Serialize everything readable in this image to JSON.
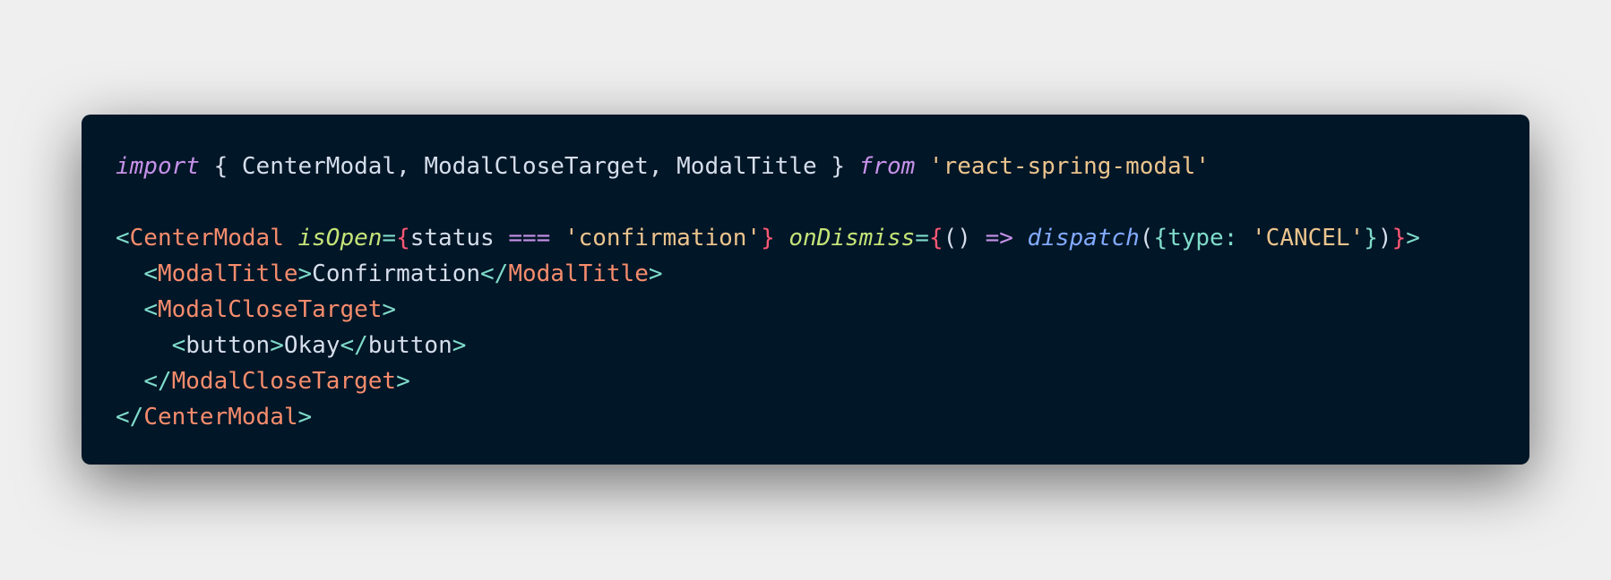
{
  "colors": {
    "page_background": "#efefef",
    "editor_background": "#011627",
    "plain": "#d6deeb",
    "keyword": "#c792ea",
    "string": "#ecc48d",
    "tag_bracket": "#7fdbca",
    "component": "#f78c6c",
    "attribute": "#c5e478",
    "jsx_brace": "#ff5874",
    "operator": "#c792ea",
    "function": "#82aaff"
  },
  "code": {
    "language": "jsx",
    "lines": [
      [
        {
          "text": "import",
          "role": "keyword",
          "italic": true
        },
        {
          "text": " { CenterModal, ModalCloseTarget, ModalTitle } ",
          "role": "plain"
        },
        {
          "text": "from",
          "role": "keyword",
          "italic": true
        },
        {
          "text": " ",
          "role": "plain"
        },
        {
          "text": "'react-spring-modal'",
          "role": "string"
        }
      ],
      [],
      [
        {
          "text": "<",
          "role": "tag_bracket"
        },
        {
          "text": "CenterModal",
          "role": "component"
        },
        {
          "text": " ",
          "role": "plain"
        },
        {
          "text": "isOpen",
          "role": "attribute",
          "italic": true
        },
        {
          "text": "=",
          "role": "tag_bracket"
        },
        {
          "text": "{",
          "role": "jsx_brace"
        },
        {
          "text": "status ",
          "role": "plain"
        },
        {
          "text": "===",
          "role": "operator"
        },
        {
          "text": " ",
          "role": "plain"
        },
        {
          "text": "'confirmation'",
          "role": "string"
        },
        {
          "text": "}",
          "role": "jsx_brace"
        },
        {
          "text": " ",
          "role": "plain"
        },
        {
          "text": "onDismiss",
          "role": "attribute",
          "italic": true
        },
        {
          "text": "=",
          "role": "tag_bracket"
        },
        {
          "text": "{",
          "role": "jsx_brace"
        },
        {
          "text": "() ",
          "role": "plain"
        },
        {
          "text": "=>",
          "role": "operator"
        },
        {
          "text": " ",
          "role": "plain"
        },
        {
          "text": "dispatch",
          "role": "function",
          "italic": true
        },
        {
          "text": "(",
          "role": "plain"
        },
        {
          "text": "{type: ",
          "role": "tag_bracket"
        },
        {
          "text": "'CANCEL'",
          "role": "string"
        },
        {
          "text": "}",
          "role": "tag_bracket"
        },
        {
          "text": ")",
          "role": "plain"
        },
        {
          "text": "}",
          "role": "jsx_brace"
        },
        {
          "text": ">",
          "role": "tag_bracket"
        }
      ],
      [
        {
          "text": "  ",
          "role": "plain"
        },
        {
          "text": "<",
          "role": "tag_bracket"
        },
        {
          "text": "ModalTitle",
          "role": "component"
        },
        {
          "text": ">",
          "role": "tag_bracket"
        },
        {
          "text": "Confirmation",
          "role": "plain"
        },
        {
          "text": "</",
          "role": "tag_bracket"
        },
        {
          "text": "ModalTitle",
          "role": "component"
        },
        {
          "text": ">",
          "role": "tag_bracket"
        }
      ],
      [
        {
          "text": "  ",
          "role": "plain"
        },
        {
          "text": "<",
          "role": "tag_bracket"
        },
        {
          "text": "ModalCloseTarget",
          "role": "component"
        },
        {
          "text": ">",
          "role": "tag_bracket"
        }
      ],
      [
        {
          "text": "    ",
          "role": "plain"
        },
        {
          "text": "<",
          "role": "tag_bracket"
        },
        {
          "text": "button",
          "role": "plain"
        },
        {
          "text": ">",
          "role": "tag_bracket"
        },
        {
          "text": "Okay",
          "role": "plain"
        },
        {
          "text": "</",
          "role": "tag_bracket"
        },
        {
          "text": "button",
          "role": "plain"
        },
        {
          "text": ">",
          "role": "tag_bracket"
        }
      ],
      [
        {
          "text": "  ",
          "role": "plain"
        },
        {
          "text": "</",
          "role": "tag_bracket"
        },
        {
          "text": "ModalCloseTarget",
          "role": "component"
        },
        {
          "text": ">",
          "role": "tag_bracket"
        }
      ],
      [
        {
          "text": "</",
          "role": "tag_bracket"
        },
        {
          "text": "CenterModal",
          "role": "component"
        },
        {
          "text": ">",
          "role": "tag_bracket"
        }
      ]
    ]
  }
}
